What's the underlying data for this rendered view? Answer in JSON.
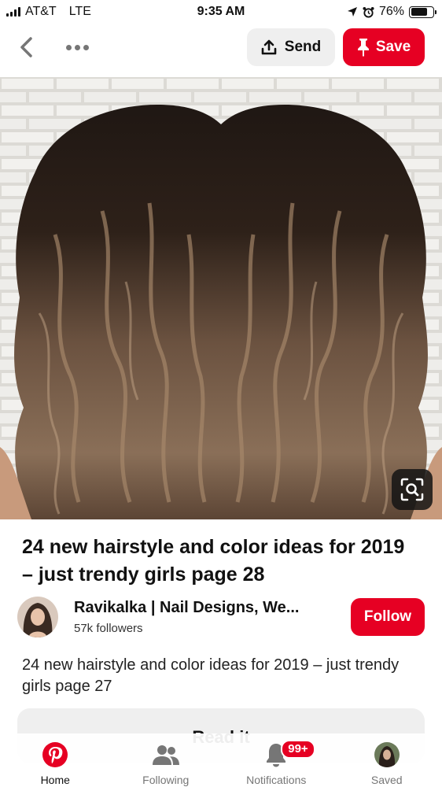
{
  "status_bar": {
    "carrier": "AT&T",
    "network": "LTE",
    "time": "9:35 AM",
    "battery": "76%",
    "battery_level": 0.76
  },
  "top_bar": {
    "send_label": "Send",
    "save_label": "Save"
  },
  "pin": {
    "title": "24 new hairstyle and color ideas for 2019 – just trendy girls page 28",
    "description": "24 new hairstyle and color ideas for 2019 – just trendy girls page 27",
    "read_it_label": "Read it"
  },
  "creator": {
    "name": "Ravikalka | Nail Designs, We...",
    "followers": "57k followers",
    "follow_label": "Follow"
  },
  "bottom_nav": {
    "items": [
      {
        "label": "Home",
        "icon": "pinterest-logo-icon",
        "active": true
      },
      {
        "label": "Following",
        "icon": "people-icon",
        "active": false
      },
      {
        "label": "Notifications",
        "icon": "bell-icon",
        "active": false,
        "badge": "99+"
      },
      {
        "label": "Saved",
        "icon": "avatar",
        "active": false
      }
    ]
  },
  "colors": {
    "brand_red": "#e60023",
    "button_gray": "#efefef",
    "text_dark": "#111111",
    "text_muted": "#767676"
  }
}
